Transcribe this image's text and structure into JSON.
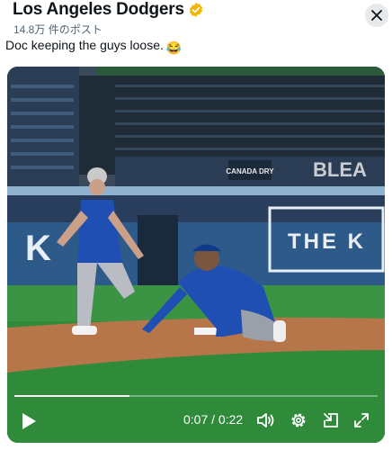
{
  "account": {
    "name": "Los Angeles Dodgers",
    "verified_icon": "verified-badge-icon"
  },
  "post_count": "14.8万 件のポスト",
  "post": {
    "text": "Doc keeping the guys loose.",
    "emoji": "😂"
  },
  "video": {
    "scene_signs": {
      "sponsor": "CANADA DRY",
      "wall_right": "THE K",
      "wall_left": "K",
      "banner": "BLEA"
    },
    "time_current": "0:07",
    "time_sep": " / ",
    "time_total": "0:22",
    "progress_fraction": 0.318,
    "controls": {
      "play_icon": "play-icon",
      "volume_icon": "volume-icon",
      "settings_icon": "gear-icon",
      "pip_icon": "picture-in-picture-icon",
      "fullscreen_icon": "fullscreen-icon"
    }
  },
  "colors": {
    "accent_gold": "#f2b705",
    "field_green": "#2f8a3a",
    "dirt": "#b7754a",
    "wall_blue": "#2e5a8a"
  }
}
